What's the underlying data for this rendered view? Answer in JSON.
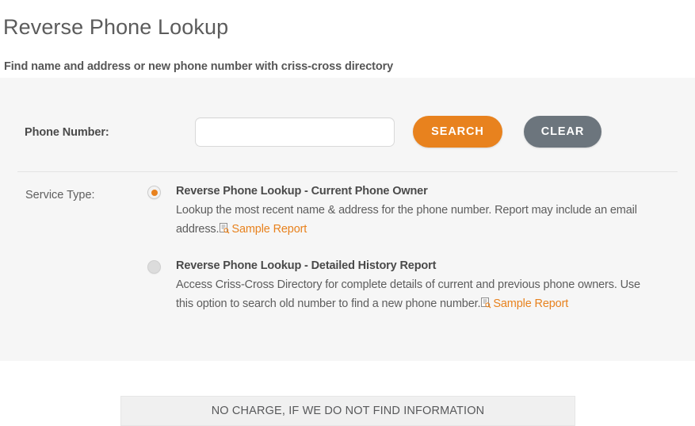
{
  "header": {
    "title": "Reverse Phone Lookup",
    "subtitle": "Find name and address or new phone number with criss-cross directory"
  },
  "form": {
    "phone_label": "Phone Number:",
    "phone_value": "",
    "phone_placeholder": "",
    "search_button": "SEARCH",
    "clear_button": "CLEAR"
  },
  "service_type": {
    "label": "Service Type:",
    "options": [
      {
        "title": "Reverse Phone Lookup - Current Phone Owner",
        "desc_part1": "Lookup the most recent name & address for the phone number. Report may include an email address.",
        "link_label": "Sample Report",
        "icon": "document-search-icon",
        "selected": true
      },
      {
        "title": "Reverse Phone Lookup - Detailed History Report",
        "desc_part1": "Access Criss-Cross Directory for complete details of current and previous phone owners. Use this option to search old number to find a new phone number.",
        "link_label": "Sample Report",
        "icon": "document-search-icon",
        "selected": false
      }
    ]
  },
  "notice": {
    "text": "NO CHARGE, IF WE DO NOT FIND INFORMATION"
  },
  "colors": {
    "accent_orange": "#e8821e",
    "clear_gray": "#6c757d",
    "panel_bg": "#f6f6f6",
    "banner_bg": "#f0f0f0"
  }
}
